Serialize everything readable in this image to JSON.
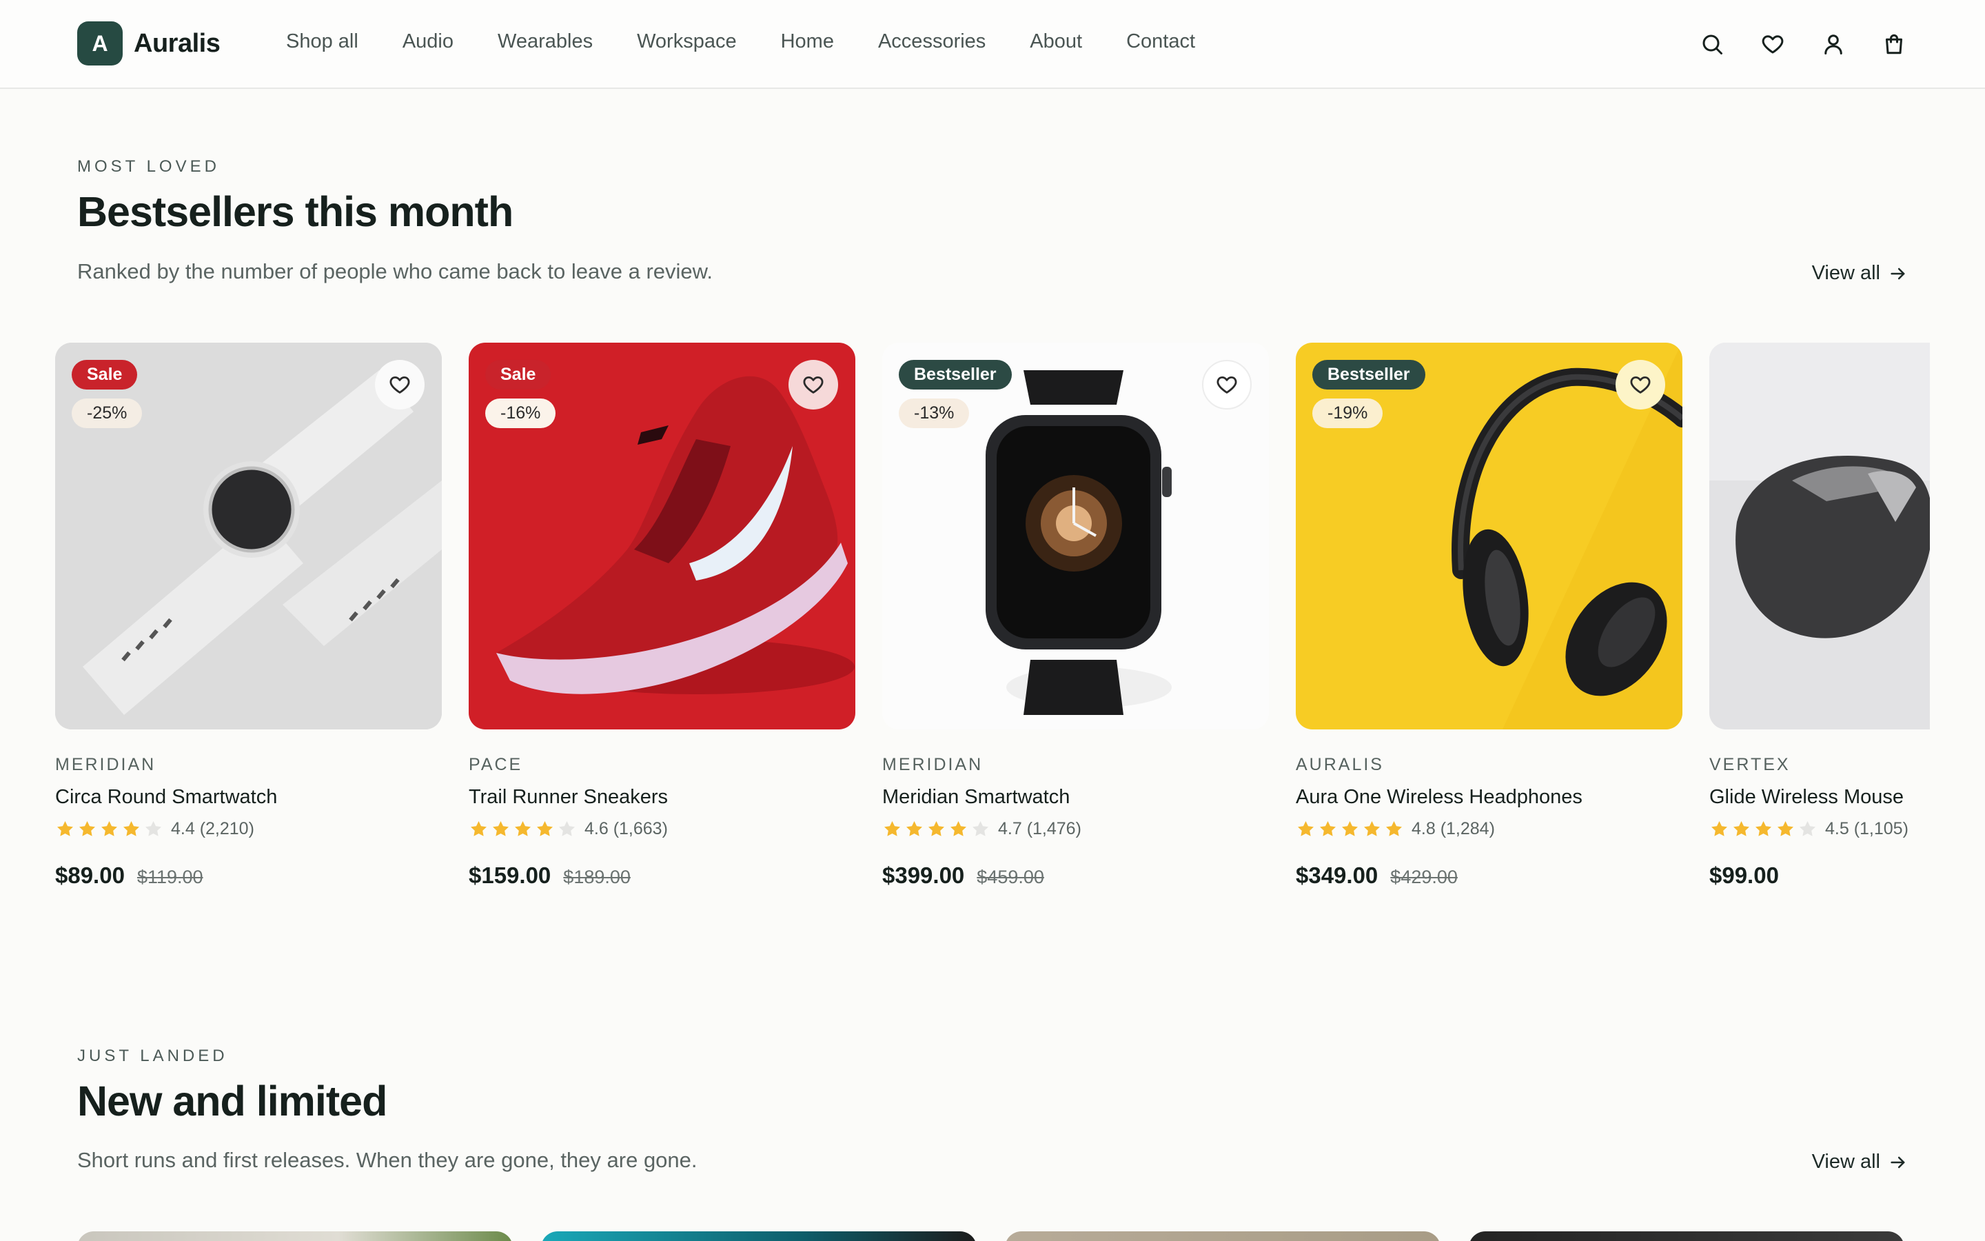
{
  "header": {
    "logo_letter": "A",
    "brand": "Auralis",
    "nav": [
      "Shop all",
      "Audio",
      "Wearables",
      "Workspace",
      "Home",
      "Accessories",
      "About",
      "Contact"
    ],
    "icons": [
      "search-icon",
      "heart-icon",
      "user-icon",
      "bag-icon"
    ]
  },
  "bestsellers": {
    "eyebrow": "MOST LOVED",
    "title": "Bestsellers this month",
    "subtitle": "Ranked by the number of people who came back to leave a review.",
    "view_all": "View all",
    "products": [
      {
        "badge": "Sale",
        "discount": "-25%",
        "brand": "MERIDIAN",
        "name": "Circa Round Smartwatch",
        "rating_value": 4.4,
        "rating": "4.4 (2,210)",
        "price": "$89.00",
        "old_price": "$119.00"
      },
      {
        "badge": "Sale",
        "discount": "-16%",
        "brand": "PACE",
        "name": "Trail Runner Sneakers",
        "rating_value": 4.6,
        "rating": "4.6 (1,663)",
        "price": "$159.00",
        "old_price": "$189.00"
      },
      {
        "badge": "Bestseller",
        "discount": "-13%",
        "brand": "MERIDIAN",
        "name": "Meridian Smartwatch",
        "rating_value": 4.7,
        "rating": "4.7 (1,476)",
        "price": "$399.00",
        "old_price": "$459.00"
      },
      {
        "badge": "Bestseller",
        "discount": "-19%",
        "brand": "AURALIS",
        "name": "Aura One Wireless Headphones",
        "rating_value": 4.8,
        "rating": "4.8 (1,284)",
        "price": "$349.00",
        "old_price": "$429.00"
      },
      {
        "badge": "",
        "discount": "",
        "brand": "VERTEX",
        "name": "Glide Wireless Mouse",
        "rating_value": 4.5,
        "rating": "4.5 (1,105)",
        "price": "$99.00",
        "old_price": ""
      }
    ]
  },
  "new_limited": {
    "eyebrow": "JUST LANDED",
    "title": "New and limited",
    "subtitle": "Short runs and first releases. When they are gone, they are gone.",
    "view_all": "View all"
  },
  "colors": {
    "brand": "#264a42",
    "sale": "#c9232b",
    "bestseller": "#2c4a44",
    "star": "#f5b82e",
    "star_empty": "#e4e4e2",
    "background": "#fbfbf9"
  }
}
